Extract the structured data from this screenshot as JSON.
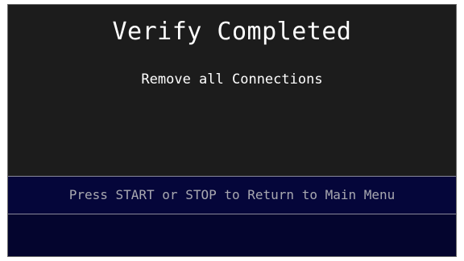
{
  "screen": {
    "title": "Verify Completed",
    "message": "Remove all Connections",
    "prompt": "Press START or STOP to Return to Main Menu"
  },
  "colors": {
    "background": "#1c1c1c",
    "status_bar": "#05063a",
    "title_text": "#ffffff",
    "prompt_text": "#a8a8b0"
  }
}
